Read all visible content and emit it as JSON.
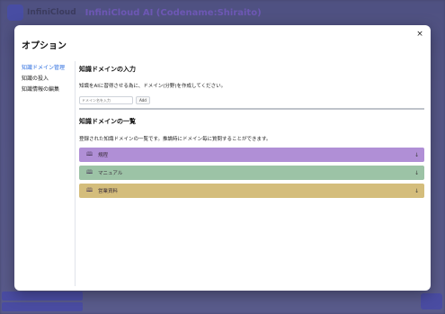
{
  "app": {
    "logo_text": "InfiniCloud",
    "title": "InfiniCloud AI (Codename:Shiraito)"
  },
  "modal": {
    "title": "オプション",
    "close_glyph": "×"
  },
  "sidebar": {
    "items": [
      {
        "label": "知識ドメイン管理",
        "active": true
      },
      {
        "label": "知識の投入",
        "active": false
      },
      {
        "label": "知識情報の編集",
        "active": false
      }
    ]
  },
  "input_section": {
    "heading": "知識ドメインの入力",
    "description": "知識をAIに習得させる為に、ドメイン(分野)を作成してください。",
    "placeholder": "ドメイン名を入力",
    "add_label": "Add"
  },
  "list_section": {
    "heading": "知識ドメインの一覧",
    "description": "登録された知識ドメインの一覧です。推論時にドメイン毎に質問することができます。"
  },
  "domains": [
    {
      "label": "規程",
      "icon": "book-icon",
      "color": "#b08fd6",
      "arrow": "↓"
    },
    {
      "label": "マニュアル",
      "icon": "book-icon",
      "color": "#9cc3a6",
      "arrow": "↓"
    },
    {
      "label": "営業資料",
      "icon": "book-icon",
      "color": "#d4bd7c",
      "arrow": "↓"
    }
  ],
  "colors": {
    "accent": "#2f6fe0",
    "backdrop": "#4a4d86"
  }
}
